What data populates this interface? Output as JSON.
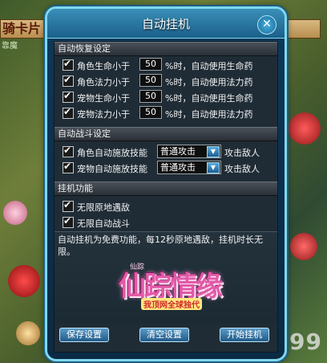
{
  "background": {
    "top_label": "骑卡片",
    "sub_label": "靠魔",
    "watermark": "4399"
  },
  "window": {
    "title": "自动挂机",
    "close_icon": "close-icon"
  },
  "recovery": {
    "header": "自动恢复设定",
    "rows": [
      {
        "label": "角色生命小于",
        "value": "50",
        "suffix": "%时，自动使用生命药",
        "checked": true
      },
      {
        "label": "角色法力小于",
        "value": "50",
        "suffix": "%时，自动使用法力药",
        "checked": true
      },
      {
        "label": "宠物生命小于",
        "value": "50",
        "suffix": "%时，自动使用生命药",
        "checked": true
      },
      {
        "label": "宠物法力小于",
        "value": "50",
        "suffix": "%时，自动使用法力药",
        "checked": true
      }
    ]
  },
  "combat": {
    "header": "自动战斗设定",
    "rows": [
      {
        "label": "角色自动施放技能",
        "skill": "普通攻击",
        "target": "攻击敌人",
        "checked": true
      },
      {
        "label": "宠物自动施放技能",
        "skill": "普通攻击",
        "target": "攻击敌人",
        "checked": true
      }
    ]
  },
  "idle": {
    "header": "挂机功能",
    "rows": [
      {
        "label": "无限原地遇敌",
        "checked": true
      },
      {
        "label": "无限自动战斗",
        "checked": true
      }
    ]
  },
  "description": {
    "text": "自动挂机为免费功能，每12秒原地遇敌，挂机时长无限。",
    "logo_text": "仙踪情缘",
    "logo_small": "仙踪",
    "logo_sub": "我顶网全球独代"
  },
  "buttons": {
    "save": "保存设置",
    "clear": "清空设置",
    "start": "开始挂机"
  }
}
